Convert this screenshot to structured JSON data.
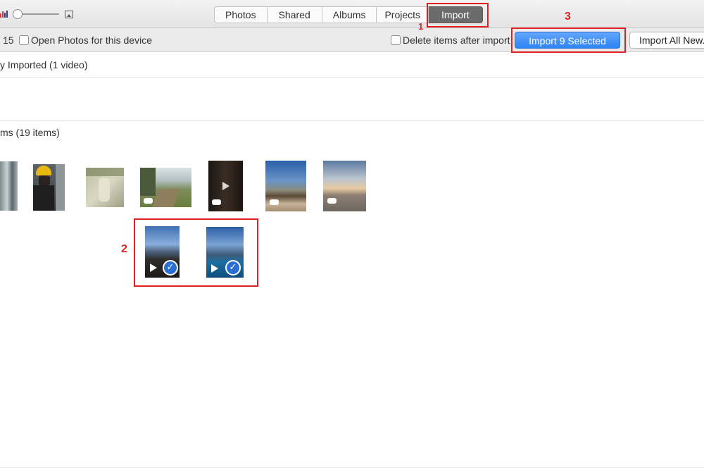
{
  "toolbar": {
    "tabs": [
      {
        "label": "Photos"
      },
      {
        "label": "Shared"
      },
      {
        "label": "Albums"
      },
      {
        "label": "Projects"
      },
      {
        "label": "Import"
      }
    ],
    "active_tab": "Import"
  },
  "import_bar": {
    "device_count_partial": "15",
    "open_photos_label": "Open Photos for this device",
    "delete_after_import_label": "Delete items after import",
    "import_selected_label": "Import 9 Selected",
    "import_all_label": "Import All New..."
  },
  "sections": {
    "already_imported": "y Imported (1 video)",
    "new_items": "ms (19 items)"
  },
  "annotations": {
    "step1": "1",
    "step2": "2",
    "step3": "3",
    "color": "#e02020"
  },
  "thumbnails": [
    {
      "kind": "photo",
      "selected": false
    },
    {
      "kind": "photo",
      "selected": false
    },
    {
      "kind": "photo",
      "selected": false
    },
    {
      "kind": "video",
      "selected": false
    },
    {
      "kind": "video",
      "selected": false
    },
    {
      "kind": "video",
      "selected": false
    },
    {
      "kind": "video",
      "selected": false
    },
    {
      "kind": "video",
      "selected": true
    },
    {
      "kind": "video",
      "selected": true
    }
  ],
  "colors": {
    "accent_blue": "#2e83f3",
    "active_tab": "#6b6b6b"
  }
}
